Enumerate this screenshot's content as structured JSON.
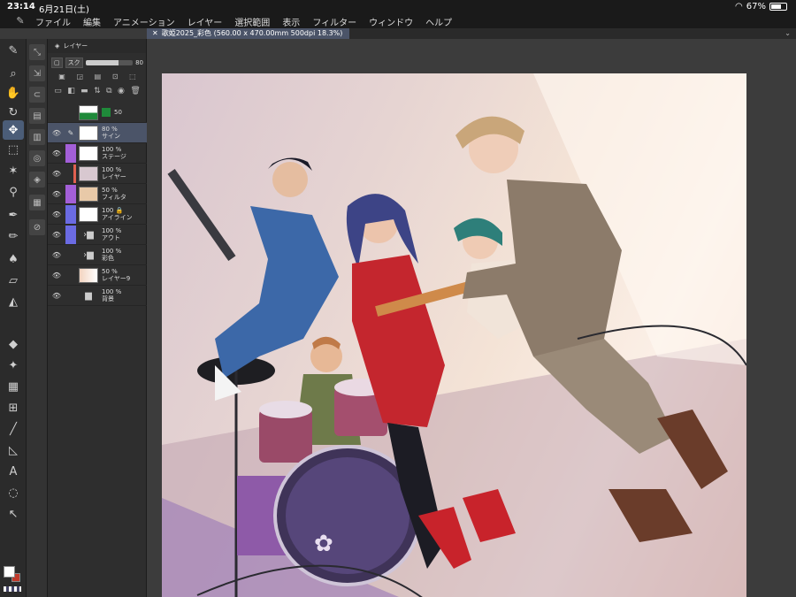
{
  "status_bar": {
    "time": "23:14",
    "date": "6月21日(土)",
    "battery": "67%",
    "battery_level": 0.67
  },
  "menu": {
    "items": [
      "ファイル",
      "編集",
      "アニメーション",
      "レイヤー",
      "選択範囲",
      "表示",
      "フィルター",
      "ウィンドウ",
      "ヘルプ"
    ]
  },
  "document_tab": {
    "close_glyph": "✕",
    "title": "歌姫2025_彩色 (560.00 x 470.00mm 500dpi 18.3%)"
  },
  "layer_panel": {
    "title": "レイヤー",
    "blend_mode": "スク",
    "opacity": "80",
    "layers": [
      {
        "opacity": "50",
        "name": "50 %",
        "color": "#1f8a3a",
        "tag": "",
        "selected": false
      },
      {
        "opacity": "80 %",
        "name": "サイン",
        "tag": "",
        "selected": true
      },
      {
        "opacity": "100 %",
        "name": "ステージ",
        "tag": "purple",
        "selected": false
      },
      {
        "opacity": "100 %",
        "name": "レイヤー",
        "tag": "",
        "selected": false
      },
      {
        "opacity": "50 %",
        "name": "フィルタ",
        "tag": "purple",
        "selected": false
      },
      {
        "opacity": "100",
        "name": "アイライン",
        "tag": "blue",
        "selected": false
      },
      {
        "opacity": "100 %",
        "name": "アウト",
        "tag": "blue",
        "folder": true,
        "selected": false
      },
      {
        "opacity": "100 %",
        "name": "彩色",
        "tag": "",
        "folder": true,
        "selected": false
      },
      {
        "opacity": "50 %",
        "name": "レイヤー9",
        "tag": "",
        "selected": false
      },
      {
        "opacity": "100 %",
        "name": "背景",
        "tag": "",
        "folder": true,
        "selected": false
      }
    ]
  },
  "tools": [
    "brush-icon",
    "zoom-icon",
    "hand-icon",
    "rotate-icon",
    "move-icon",
    "select-icon",
    "magic-wand-icon",
    "eyedropper-icon",
    "pen-icon",
    "pencil-icon",
    "airbrush-icon",
    "eraser-icon",
    "fill-icon",
    "gradient-icon",
    "frame-icon",
    "line-icon",
    "ruler-icon",
    "text-icon",
    "balloon-icon",
    "correct-line-icon"
  ],
  "colors": {
    "accent": "#4b5468",
    "main_color": "#ffffff",
    "sub_color": "#c0392b"
  }
}
